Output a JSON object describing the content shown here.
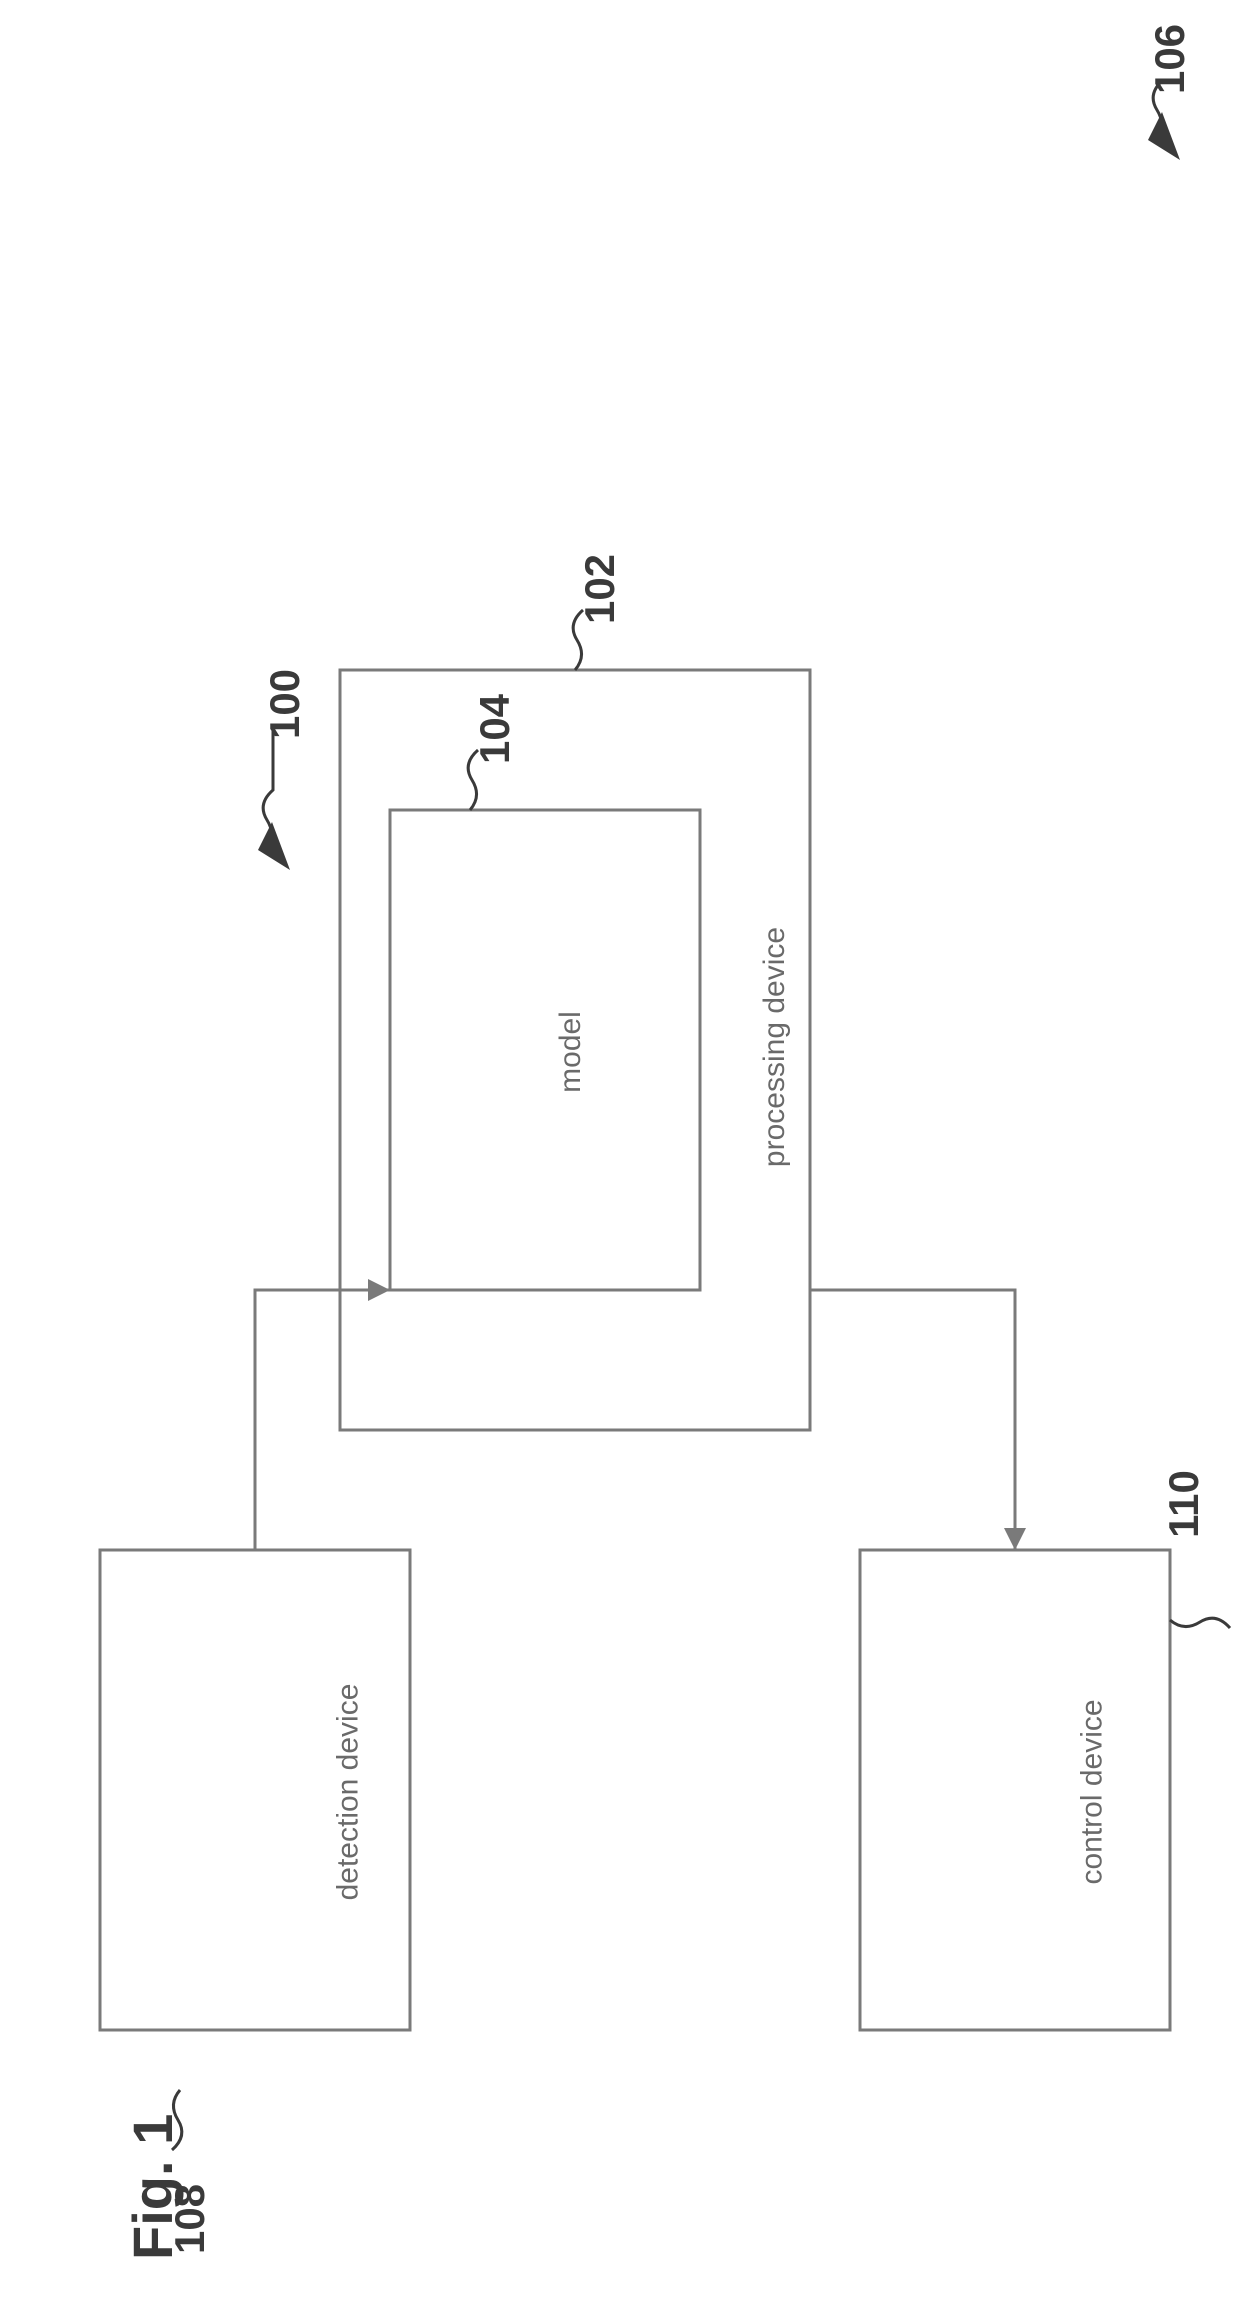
{
  "figure": {
    "title": "Fig. 1"
  },
  "refs": {
    "r100": "100",
    "r102": "102",
    "r104": "104",
    "r106": "106",
    "r108": "108",
    "r110": "110"
  },
  "boxes": {
    "processing": "processing device",
    "model": "model",
    "detection": "detection device",
    "control": "control device"
  }
}
